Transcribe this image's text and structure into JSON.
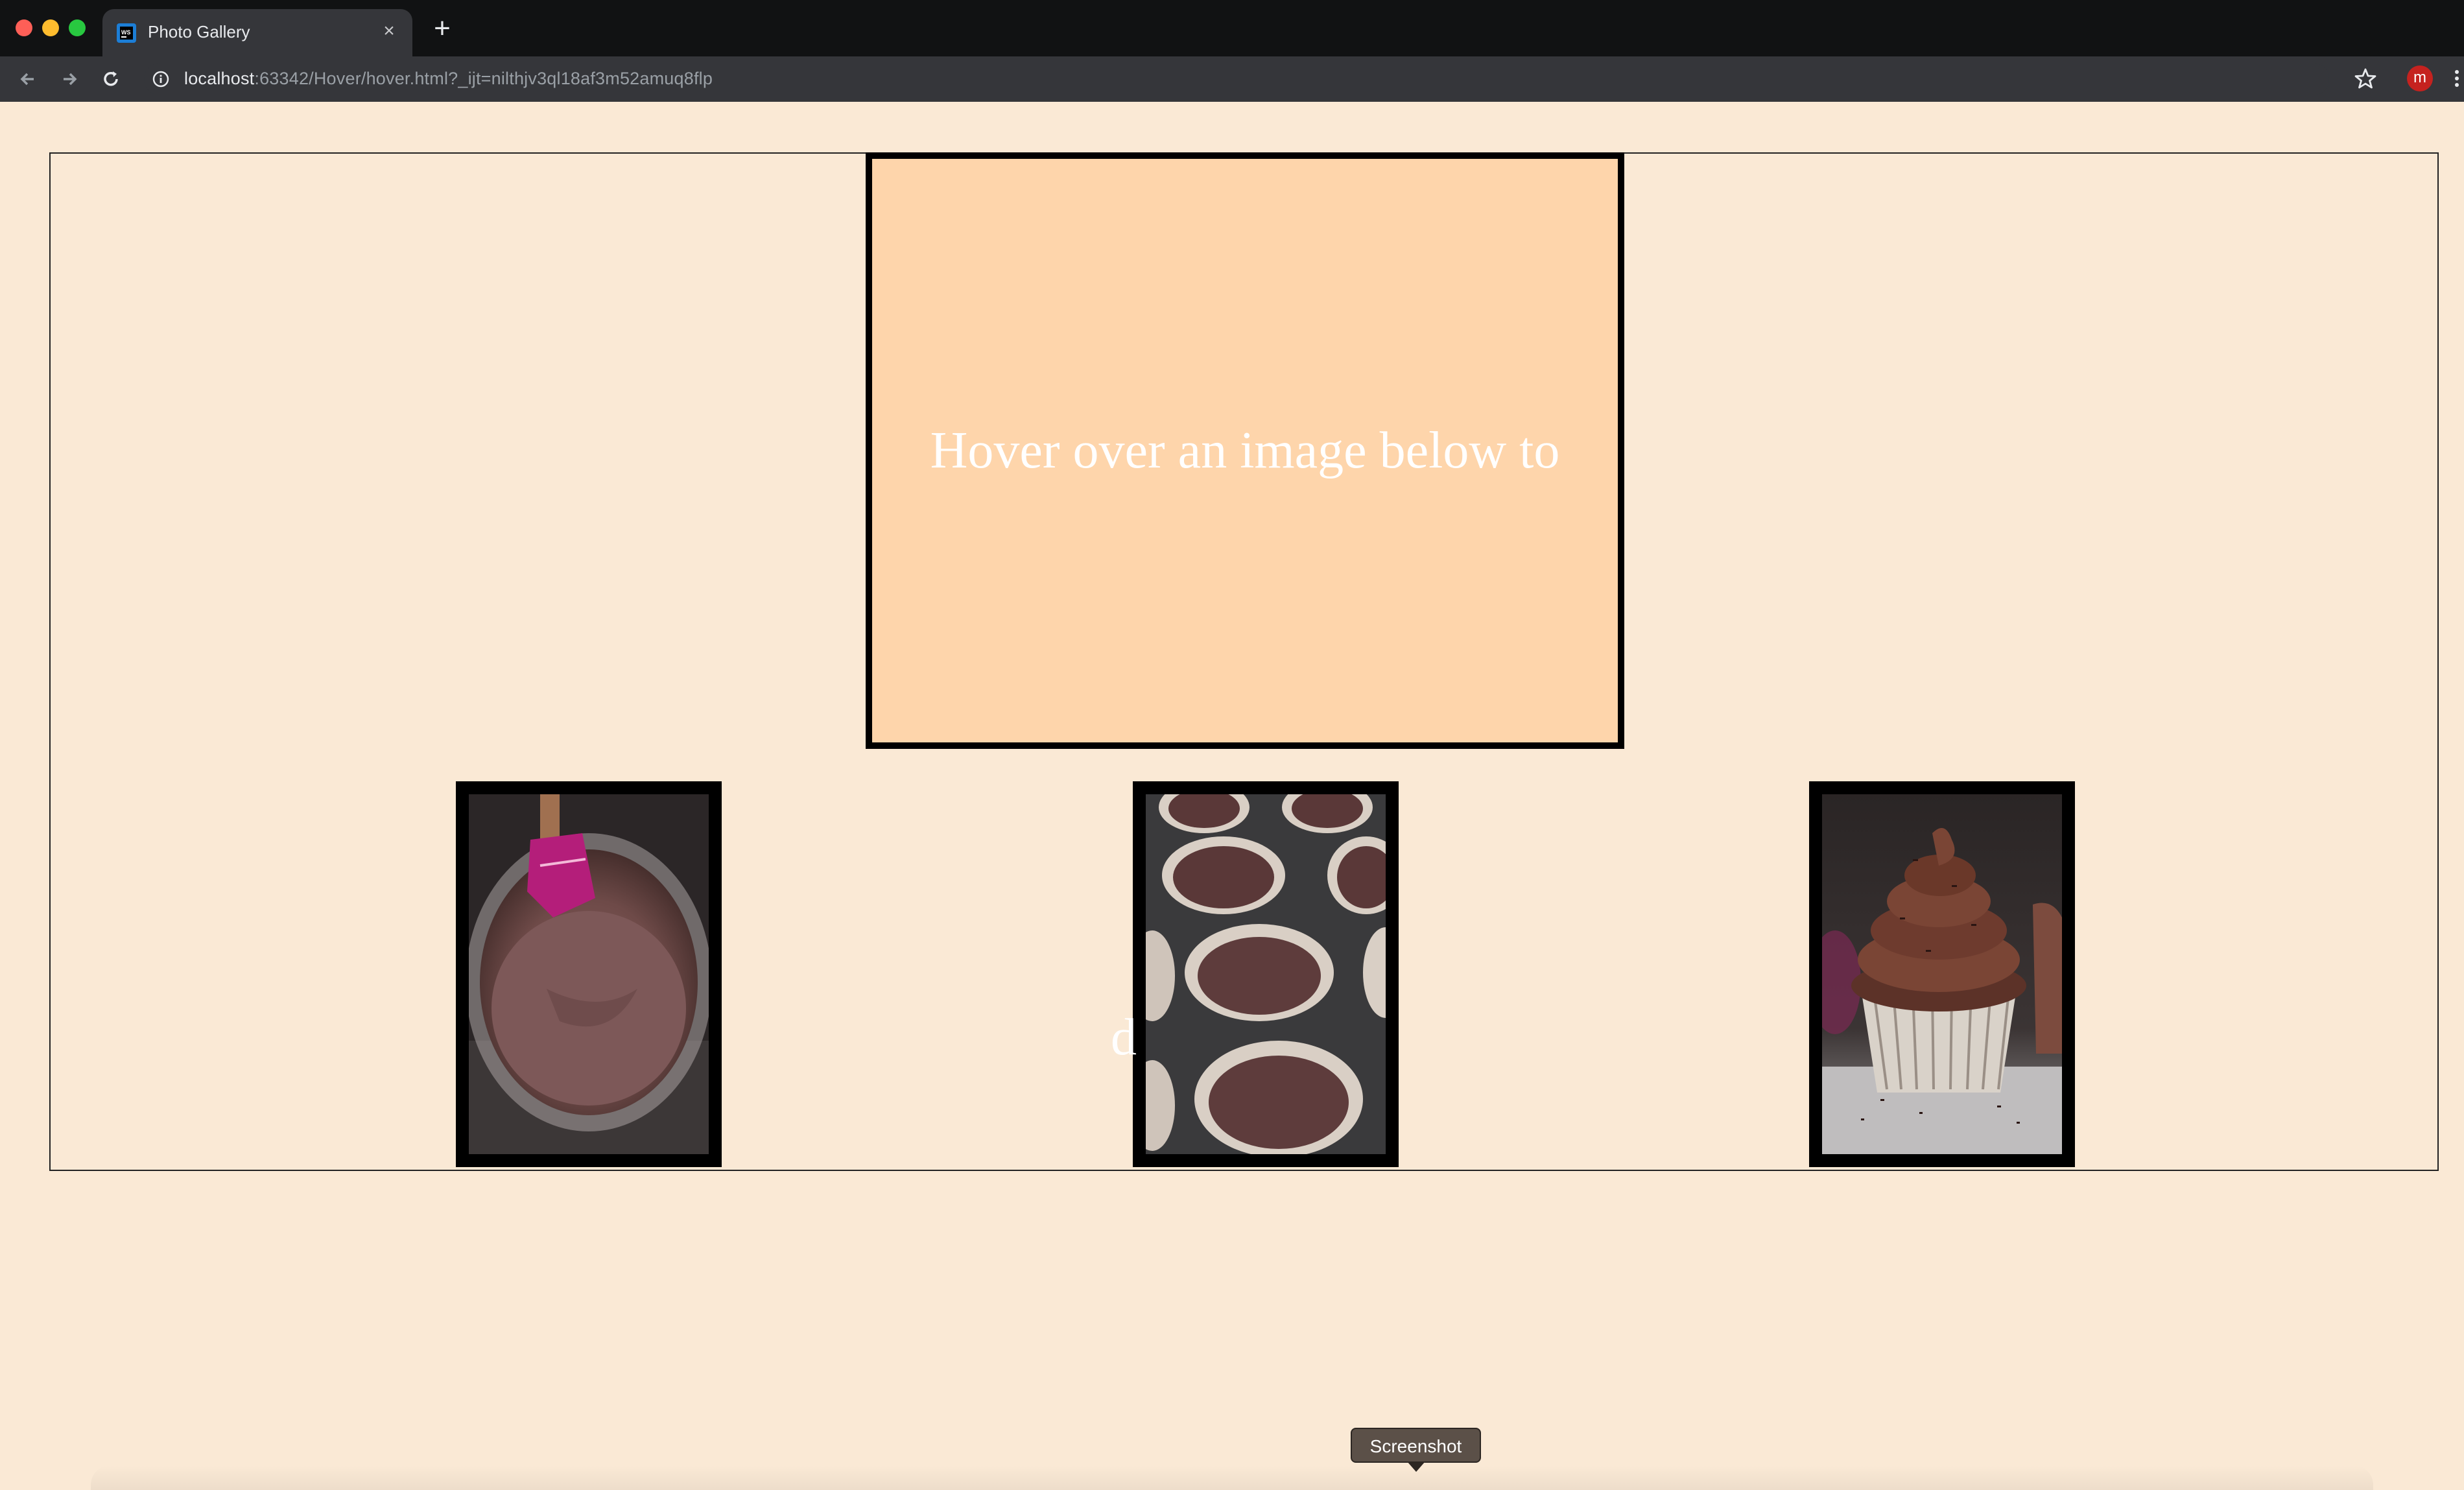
{
  "browser": {
    "tab": {
      "title": "Photo Gallery",
      "close_icon": "close-icon",
      "favicon": "webstorm-icon"
    },
    "new_tab_icon": "plus-icon",
    "nav": {
      "back_icon": "back-arrow-icon",
      "forward_icon": "forward-arrow-icon",
      "reload_icon": "reload-icon"
    },
    "address": {
      "host": "localhost",
      "rest": ":63342/Hover/hover.html?_ijt=nilthjv3ql18af3m52amuq8flp"
    },
    "bookmark_icon": "star-icon",
    "profile_initial": "m",
    "menu_icon": "kebab-menu-icon"
  },
  "page": {
    "preview_text": "Hover over an image below to",
    "stray_text": "d",
    "images": [
      {
        "name": "batter-bowl",
        "description_icon": "chocolate-batter-photo"
      },
      {
        "name": "cupcake-tin",
        "description_icon": "cupcake-liners-photo"
      },
      {
        "name": "frosted-cupcake",
        "description_icon": "frosted-cupcake-photo"
      }
    ]
  },
  "os": {
    "tooltip": "Screenshot"
  },
  "colors": {
    "page_background": "#fae9d5",
    "preview_background": "#fed5ab",
    "preview_border": "#000000",
    "preview_text": "#ffffff",
    "chrome_dark": "#35363a"
  }
}
